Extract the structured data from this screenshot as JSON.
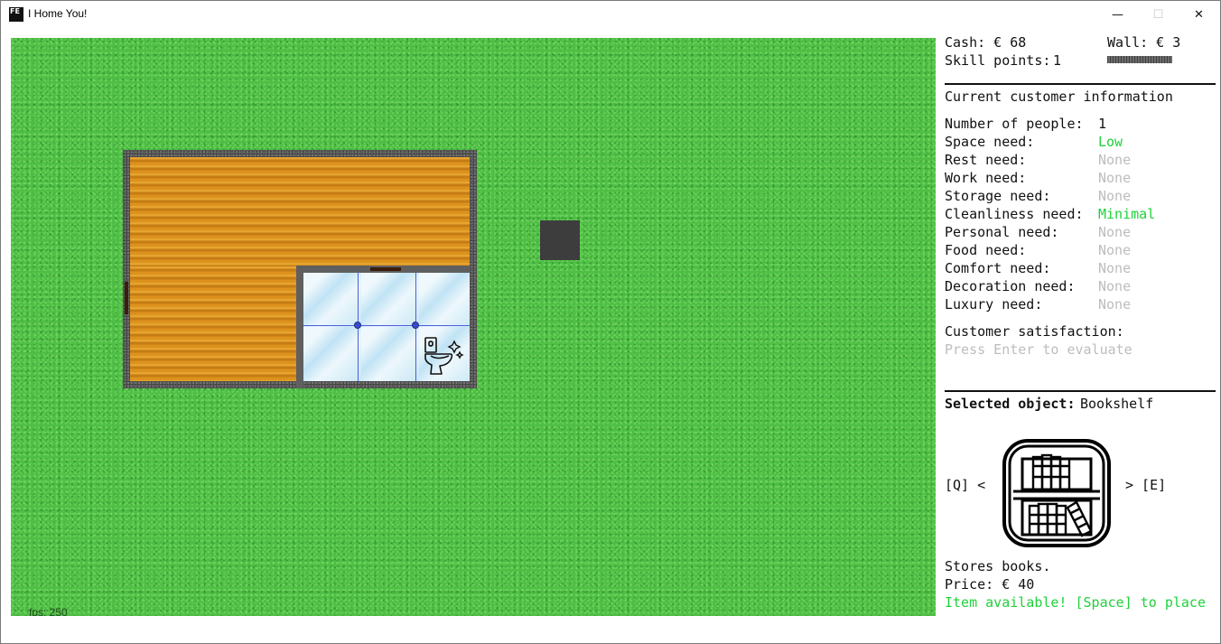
{
  "window": {
    "title": "I Home You!",
    "icon_text": "FE",
    "controls": {
      "minimize": "—",
      "maximize": "☐",
      "close": "✕"
    }
  },
  "game": {
    "fps_text": "fps: 250",
    "colors": {
      "grass": "#4fbe45",
      "wood": "#d98e1a",
      "wall": "#5f5f5f",
      "tile": "#d6eef8",
      "placement_grid": "#4b5de0",
      "stone": "#3d3d3d"
    },
    "icons": [
      "toilet-icon",
      "sparkle-icon"
    ]
  },
  "stats": {
    "cash": "Cash: € 68",
    "wall": "Wall: € 3",
    "skill_label": "Skill points:",
    "skill_value": "1"
  },
  "customer": {
    "heading": "Current customer information",
    "needs": [
      {
        "label": "Number of people:",
        "value": "1",
        "status": "normal"
      },
      {
        "label": "Space need:",
        "value": "Low",
        "status": "active"
      },
      {
        "label": "Rest need:",
        "value": "None",
        "status": "none"
      },
      {
        "label": "Work need:",
        "value": "None",
        "status": "none"
      },
      {
        "label": "Storage need:",
        "value": "None",
        "status": "none"
      },
      {
        "label": "Cleanliness need:",
        "value": "Minimal",
        "status": "active"
      },
      {
        "label": "Personal need:",
        "value": "None",
        "status": "none"
      },
      {
        "label": "Food need:",
        "value": "None",
        "status": "none"
      },
      {
        "label": "Comfort need:",
        "value": "None",
        "status": "none"
      },
      {
        "label": "Decoration need:",
        "value": "None",
        "status": "none"
      },
      {
        "label": "Luxury need:",
        "value": "None",
        "status": "none"
      }
    ],
    "satisfaction_label": "Customer satisfaction:",
    "satisfaction_hint": "Press Enter to evaluate"
  },
  "selected": {
    "label": "Selected object:",
    "name": "Bookshelf",
    "prev": "[Q] <",
    "next": "> [E]",
    "icon": "bookshelf-icon",
    "description": "Stores books.",
    "price": "Price: € 40",
    "availability": "Item available! [Space] to place"
  },
  "palette": {
    "active": "#1fd13a",
    "none": "#bdbdbd",
    "text": "#111111"
  }
}
